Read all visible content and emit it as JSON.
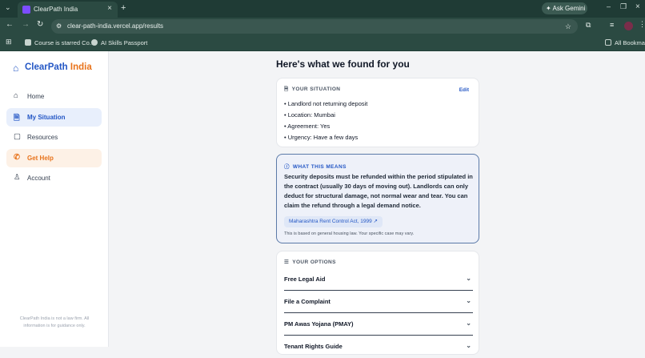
{
  "browser": {
    "tab_title": "ClearPath India",
    "new_tab": "+",
    "ask_gemini": "Ask Gemini",
    "url": "clear-path-india.vercel.app/results",
    "bookmarks": [
      "Course is starred Co...",
      "AI Skills Passport"
    ],
    "all_bookmarks": "All Bookmarks"
  },
  "sidebar": {
    "brand_primary": "ClearPath",
    "brand_accent": "India",
    "items": [
      {
        "label": "Home",
        "icon": "home-icon"
      },
      {
        "label": "My Situation",
        "icon": "document-icon"
      },
      {
        "label": "Resources",
        "icon": "book-icon"
      },
      {
        "label": "Get Help",
        "icon": "phone-icon"
      },
      {
        "label": "Account",
        "icon": "user-icon"
      }
    ],
    "disclaimer": "ClearPath India is not a law firm. All information is for guidance only."
  },
  "main": {
    "title": "Here's what we found for you",
    "situation": {
      "heading": "YOUR SITUATION",
      "edit": "Edit",
      "lines": [
        "• Landlord not returning deposit",
        "• Location: Mumbai",
        "• Agreement: Yes",
        "• Urgency: Have a few days"
      ]
    },
    "meaning": {
      "heading": "WHAT THIS MEANS",
      "body": "Security deposits must be refunded within the period stipulated in the contract (usually 30 days of moving out). Landlords can only deduct for structural damage, not normal wear and tear. You can claim the refund through a legal demand notice.",
      "law_link": "Maharashtra Rent Control Act, 1999",
      "note": "This is based on general housing law. Your specific case may vary."
    },
    "options": {
      "heading": "YOUR OPTIONS",
      "items": [
        "Free Legal Aid",
        "File a Complaint",
        "PM Awas Yojana (PMAY)",
        "Tenant Rights Guide"
      ]
    }
  },
  "colors": {
    "brand_blue": "#2457c5",
    "brand_orange": "#e8731b",
    "chrome_green": "#2b4a42"
  }
}
